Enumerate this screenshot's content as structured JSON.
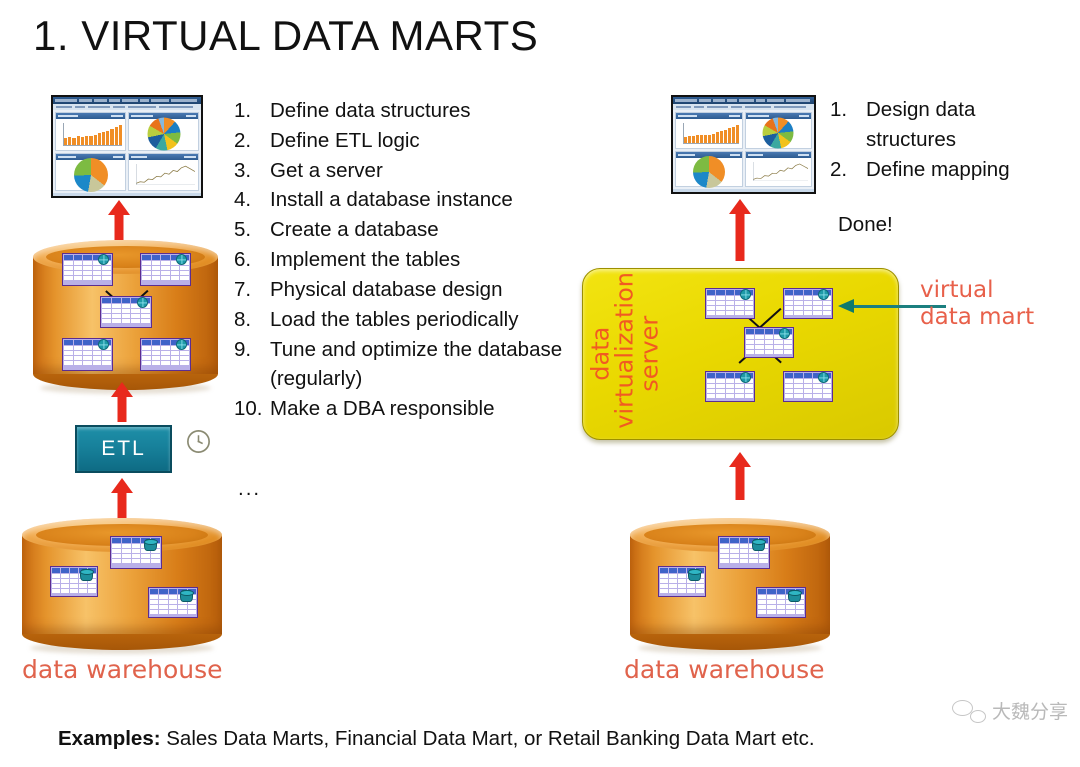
{
  "title": "1. VIRTUAL DATA MARTS",
  "traditional": {
    "steps": [
      {
        "num": "1.",
        "text": "Define data structures"
      },
      {
        "num": "2.",
        "text": "Define ETL logic"
      },
      {
        "num": "3.",
        "text": "Get a server"
      },
      {
        "num": "4.",
        "text": "Install a database instance"
      },
      {
        "num": "5.",
        "text": "Create a database"
      },
      {
        "num": "6.",
        "text": "Implement the tables"
      },
      {
        "num": "7.",
        "text": "Physical database design"
      },
      {
        "num": "8.",
        "text": "Load the tables periodically"
      },
      {
        "num": "9.",
        "text": "Tune and optimize the database (regularly)"
      },
      {
        "num": "10.",
        "text": "Make a DBA responsible"
      }
    ],
    "continuation": "...",
    "etl_label": "ETL",
    "clock_icon": "clock-icon",
    "warehouse_label": "data warehouse"
  },
  "virtual": {
    "steps": [
      {
        "num": "1.",
        "text": "Design data structures"
      },
      {
        "num": "2.",
        "text": "Define mapping"
      }
    ],
    "done_label": "Done!",
    "server_label_lines": [
      "data",
      "virtualization",
      "server"
    ],
    "callout_lines": [
      "virtual",
      "data mart"
    ],
    "warehouse_label": "data warehouse"
  },
  "caption": {
    "lead": "Examples:",
    "rest": " Sales Data Marts, Financial Data Mart, or Retail Banking Data Mart etc."
  },
  "watermark": {
    "icon": "wechat-icon",
    "text": "大魏分享"
  },
  "colors": {
    "arrow_red": "#E8291C",
    "server_yellow": "#E9D800",
    "server_text_orange": "#F15A22",
    "callout_orange": "#E8604A",
    "warehouse_label": "#E0634C",
    "cylinder_orange": "#E5942C",
    "etl_teal": "#17819B",
    "pointer_teal": "#0F7A6C",
    "table_border_purple": "#5B2D91",
    "table_header_blue": "#3F63C8",
    "chart_orange": "#F08E26"
  },
  "chart_data": {
    "type": "bar",
    "title": "",
    "categories": [
      "1",
      "2",
      "3",
      "4",
      "5",
      "6",
      "7",
      "8",
      "9",
      "10",
      "11",
      "12",
      "13",
      "14"
    ],
    "values": [
      30,
      34,
      32,
      38,
      36,
      41,
      39,
      46,
      52,
      58,
      63,
      72,
      80,
      92
    ],
    "xlabel": "",
    "ylabel": "",
    "ylim": [
      0,
      100
    ],
    "grid": false,
    "legend": "none"
  },
  "dashboard_panels": {
    "bar_panel": "bar-chart-panel",
    "pie_multi_panel": "multi-slice-pie-panel",
    "pie_three_panel": "three-slice-pie-panel",
    "line_panel": "line-chart-panel"
  }
}
